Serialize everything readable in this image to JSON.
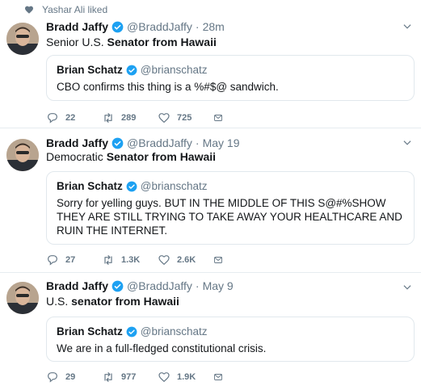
{
  "liked_by": "Yashar Ali liked",
  "tweets": [
    {
      "name": "Bradd Jaffy",
      "handle": "@BraddJaffy",
      "separator": "·",
      "time": "28m",
      "text_plain": "Senior U.S. ",
      "text_bold": "Senator from Hawaii",
      "quote": {
        "name": "Brian Schatz",
        "handle": "@brianschatz",
        "text": "CBO confirms this thing is a %#$@ sandwich."
      },
      "replies": "22",
      "retweets": "289",
      "likes": "725"
    },
    {
      "name": "Bradd Jaffy",
      "handle": "@BraddJaffy",
      "separator": "·",
      "time": "May 19",
      "text_plain": "Democratic ",
      "text_bold": "Senator from Hawaii",
      "quote": {
        "name": "Brian Schatz",
        "handle": "@brianschatz",
        "text": "Sorry for yelling guys. BUT IN THE MIDDLE OF THIS S@#%SHOW THEY ARE STILL TRYING TO TAKE AWAY YOUR HEALTHCARE AND RUIN THE INTERNET."
      },
      "replies": "27",
      "retweets": "1.3K",
      "likes": "2.6K"
    },
    {
      "name": "Bradd Jaffy",
      "handle": "@BraddJaffy",
      "separator": "·",
      "time": "May 9",
      "text_plain": "U.S. ",
      "text_bold": "senator from Hawaii",
      "quote": {
        "name": "Brian Schatz",
        "handle": "@brianschatz",
        "text": "We are in a full-fledged constitutional crisis."
      },
      "replies": "29",
      "retweets": "977",
      "likes": "1.9K"
    }
  ],
  "icons": {
    "heart": "heart-icon",
    "verified": "verified-badge-icon",
    "chevron": "chevron-down-icon",
    "reply": "reply-icon",
    "retweet": "retweet-icon",
    "like": "like-icon",
    "message": "direct-message-icon"
  },
  "colors": {
    "verified_blue": "#1da1f2",
    "secondary_text": "#657786",
    "border": "#e1e8ed"
  }
}
